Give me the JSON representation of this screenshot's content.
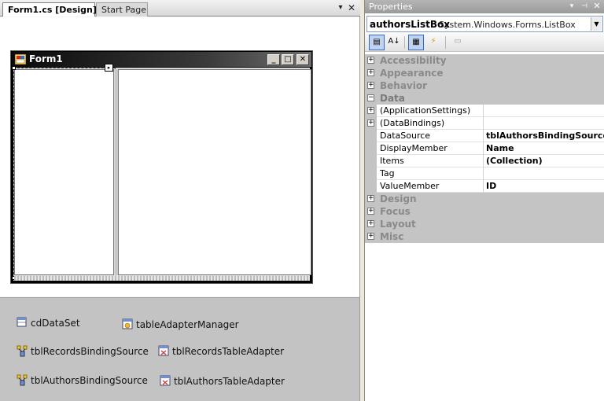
{
  "tabs": [
    {
      "label": "Form1.cs [Design]*",
      "active": true
    },
    {
      "label": "Start Page",
      "active": false
    }
  ],
  "tab_controls": {
    "dropdown": "▾",
    "close": "✕"
  },
  "form": {
    "title": "Form1",
    "buttons": {
      "minimize": "_",
      "maximize": "□",
      "close": "✕"
    },
    "smart_tag": "▸"
  },
  "tray": [
    {
      "label": "cdDataSet",
      "icon": "dataset-icon"
    },
    {
      "label": "tableAdapterManager",
      "icon": "table-adapter-manager-icon"
    },
    {
      "label": "tblRecordsBindingSource",
      "icon": "binding-source-icon"
    },
    {
      "label": "tblRecordsTableAdapter",
      "icon": "table-adapter-icon"
    },
    {
      "label": "tblAuthorsBindingSource",
      "icon": "binding-source-icon"
    },
    {
      "label": "tblAuthorsTableAdapter",
      "icon": "table-adapter-icon"
    }
  ],
  "properties": {
    "title": "Properties",
    "header_controls": {
      "dropdown": "▾",
      "pin": "⊣",
      "close": "✕"
    },
    "object_name": "authorsListBox",
    "object_type": "System.Windows.Forms.ListBox",
    "object_dropdown": "▼",
    "toolbar": {
      "categorized": "▤",
      "alphabetical": "A↓",
      "properties": "▦",
      "events": "⚡",
      "pages": "▭"
    },
    "categories": {
      "accessibility": "Accessibility",
      "appearance": "Appearance",
      "behavior": "Behavior",
      "data": "Data",
      "design": "Design",
      "focus": "Focus",
      "layout": "Layout",
      "misc": "Misc"
    },
    "expand_collapsed": "+",
    "expand_open": "−",
    "data_rows": [
      {
        "name": "(ApplicationSettings)",
        "value": "",
        "expandable": true
      },
      {
        "name": "(DataBindings)",
        "value": "",
        "expandable": true
      },
      {
        "name": "DataSource",
        "value": "tblAuthorsBindingSource",
        "expandable": false
      },
      {
        "name": "DisplayMember",
        "value": "Name",
        "expandable": false
      },
      {
        "name": "Items",
        "value": "(Collection)",
        "expandable": false
      },
      {
        "name": "Tag",
        "value": "",
        "expandable": false
      },
      {
        "name": "ValueMember",
        "value": "ID",
        "expandable": false
      }
    ]
  },
  "colors": {
    "accent": "#316ac5",
    "category_bg": "#c4c4c4",
    "tray_bg": "#c3c3c3"
  }
}
